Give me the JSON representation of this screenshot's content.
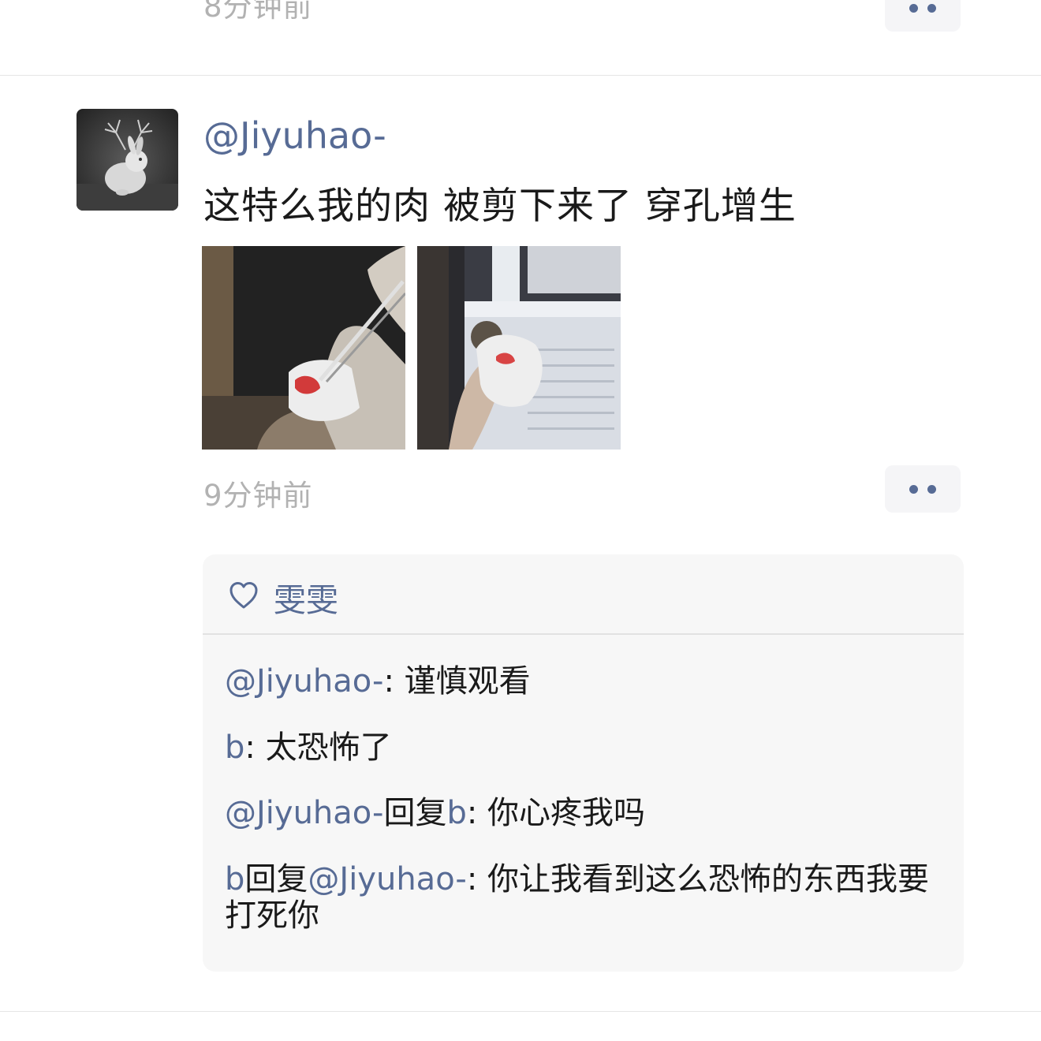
{
  "previous_post": {
    "time": "8分钟前"
  },
  "post": {
    "username": "@Jiyuhao-",
    "text": "这特么我的肉 被剪下来了 穿孔增生",
    "time": "9分钟前",
    "photo_count": 2
  },
  "likes": {
    "icon": "heart-icon",
    "names": "雯雯"
  },
  "comments": [
    {
      "author": "@Jiyuhao-",
      "reply_word": "",
      "reply_to": "",
      "colon": ": ",
      "text": "谨慎观看"
    },
    {
      "author": "b",
      "reply_word": "",
      "reply_to": "",
      "colon": ": ",
      "text": "太恐怖了"
    },
    {
      "author": "@Jiyuhao-",
      "reply_word": "回复",
      "reply_to": "b",
      "colon": ": ",
      "text": "你心疼我吗"
    },
    {
      "author": "b",
      "reply_word": "回复",
      "reply_to": "@Jiyuhao-",
      "colon": ": ",
      "text": "你让我看到这么恐怖的东西我要打死你"
    }
  ],
  "colors": {
    "link": "#576b95",
    "time": "#b2b2b2",
    "comment_bg": "#f7f7f7"
  }
}
